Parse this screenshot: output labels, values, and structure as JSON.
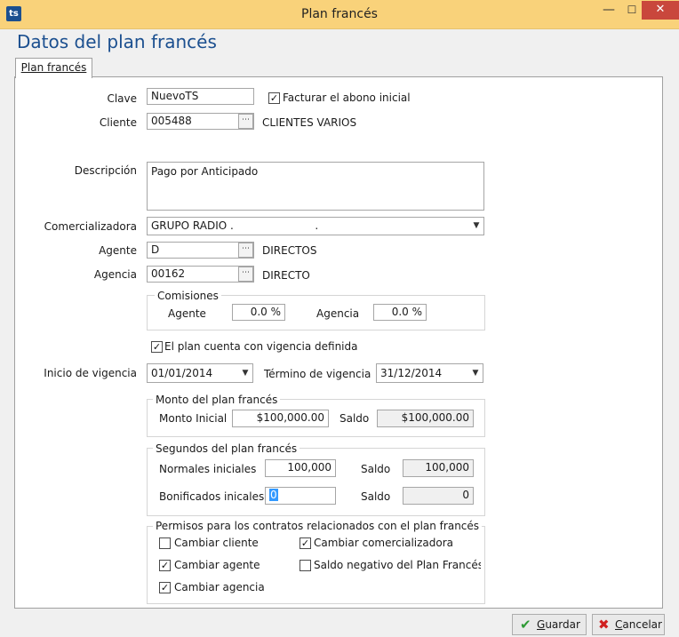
{
  "window": {
    "title": "Plan francés",
    "app_icon_text": "ts"
  },
  "heading": "Datos del plan francés",
  "tab": {
    "label": "Plan francés"
  },
  "form": {
    "clave_label": "Clave",
    "clave_value": "NuevoTS",
    "facturar_label": "Facturar el abono inicial",
    "facturar_checked": true,
    "cliente_label": "Cliente",
    "cliente_value": "005488",
    "cliente_name": "CLIENTES VARIOS",
    "descripcion_label": "Descripción",
    "descripcion_value": "Pago por Anticipado",
    "comercializadora_label": "Comercializadora",
    "comercializadora_value": "GRUPO RADIO .                        .",
    "agente_label": "Agente",
    "agente_value": "D",
    "agente_name": "DIRECTOS",
    "agencia_label": "Agencia",
    "agencia_value": "00162",
    "agencia_name": "DIRECTO"
  },
  "comisiones": {
    "title": "Comisiones",
    "agente_label": "Agente",
    "agente_value": "0.0 %",
    "agencia_label": "Agencia",
    "agencia_value": "0.0 %"
  },
  "vigencia": {
    "checkbox_label": "El plan cuenta con vigencia definida",
    "checked": true,
    "inicio_label": "Inicio de vigencia",
    "inicio_value": "01/01/2014",
    "termino_label": "Término de vigencia",
    "termino_value": "31/12/2014"
  },
  "monto": {
    "title": "Monto del plan francés",
    "inicial_label": "Monto Inicial",
    "inicial_value": "$100,000.00",
    "saldo_label": "Saldo",
    "saldo_value": "$100,000.00"
  },
  "segundos": {
    "title": "Segundos del plan francés",
    "normales_label": "Normales iniciales",
    "normales_value": "100,000",
    "saldo1_label": "Saldo",
    "saldo1_value": "100,000",
    "bonificados_label": "Bonificados inicales",
    "bonificados_value": "0",
    "saldo2_label": "Saldo",
    "saldo2_value": "0"
  },
  "permisos": {
    "title": "Permisos para los contratos relacionados con el plan francés",
    "cambiar_cliente": {
      "label": "Cambiar cliente",
      "checked": false
    },
    "cambiar_comercializadora": {
      "label": "Cambiar comercializadora",
      "checked": true
    },
    "cambiar_agente": {
      "label": "Cambiar agente",
      "checked": true
    },
    "saldo_negativo": {
      "label": "Saldo negativo del Plan Francés",
      "checked": false
    },
    "cambiar_agencia": {
      "label": "Cambiar agencia",
      "checked": true
    }
  },
  "buttons": {
    "guardar_first": "G",
    "guardar_rest": "uardar",
    "cancelar_first": "C",
    "cancelar_rest": "ancelar"
  },
  "colors": {
    "titlebar": "#f9d27a",
    "close": "#c9473c",
    "heading": "#1b4f8f",
    "ok_icon": "#2e9a35",
    "cancel_icon": "#d02020"
  }
}
